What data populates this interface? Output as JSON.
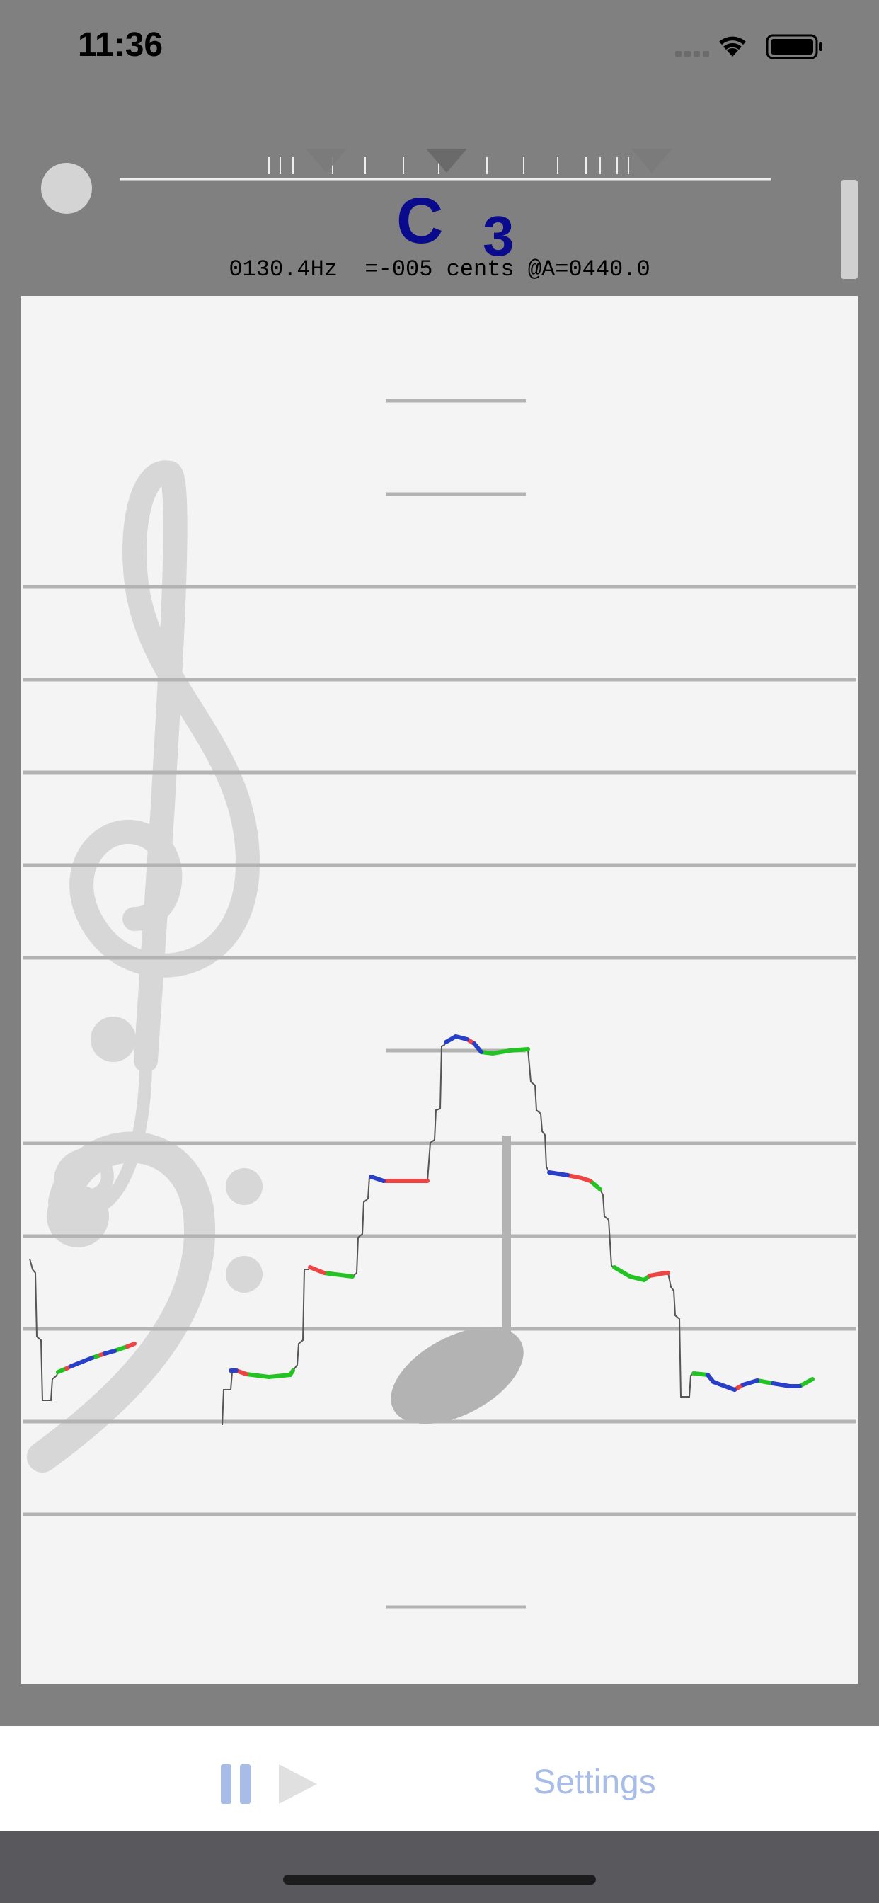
{
  "status_bar": {
    "time": "11:36"
  },
  "tuner": {
    "note_letter": "C",
    "note_octave": "3",
    "readout": "0130.4Hz  =-005 cents @A=0440.0"
  },
  "toolbar": {
    "pause_icon": "pause-icon",
    "play_icon": "play-icon",
    "settings_label": "Settings"
  },
  "colors": {
    "background": "#808080",
    "staff_background": "#f4f4f4",
    "note_text": "#0a0a8c",
    "pitch_in_tune": "#22c322",
    "pitch_sharp": "#ee4444",
    "pitch_flat": "#2a3fc8",
    "toolbar_accent": "#a7bce6"
  },
  "staff": {
    "treble_clef_icon": "treble-clef-icon",
    "bass_clef_icon": "bass-clef-icon",
    "quarter_note_icon": "quarter-note-icon"
  }
}
